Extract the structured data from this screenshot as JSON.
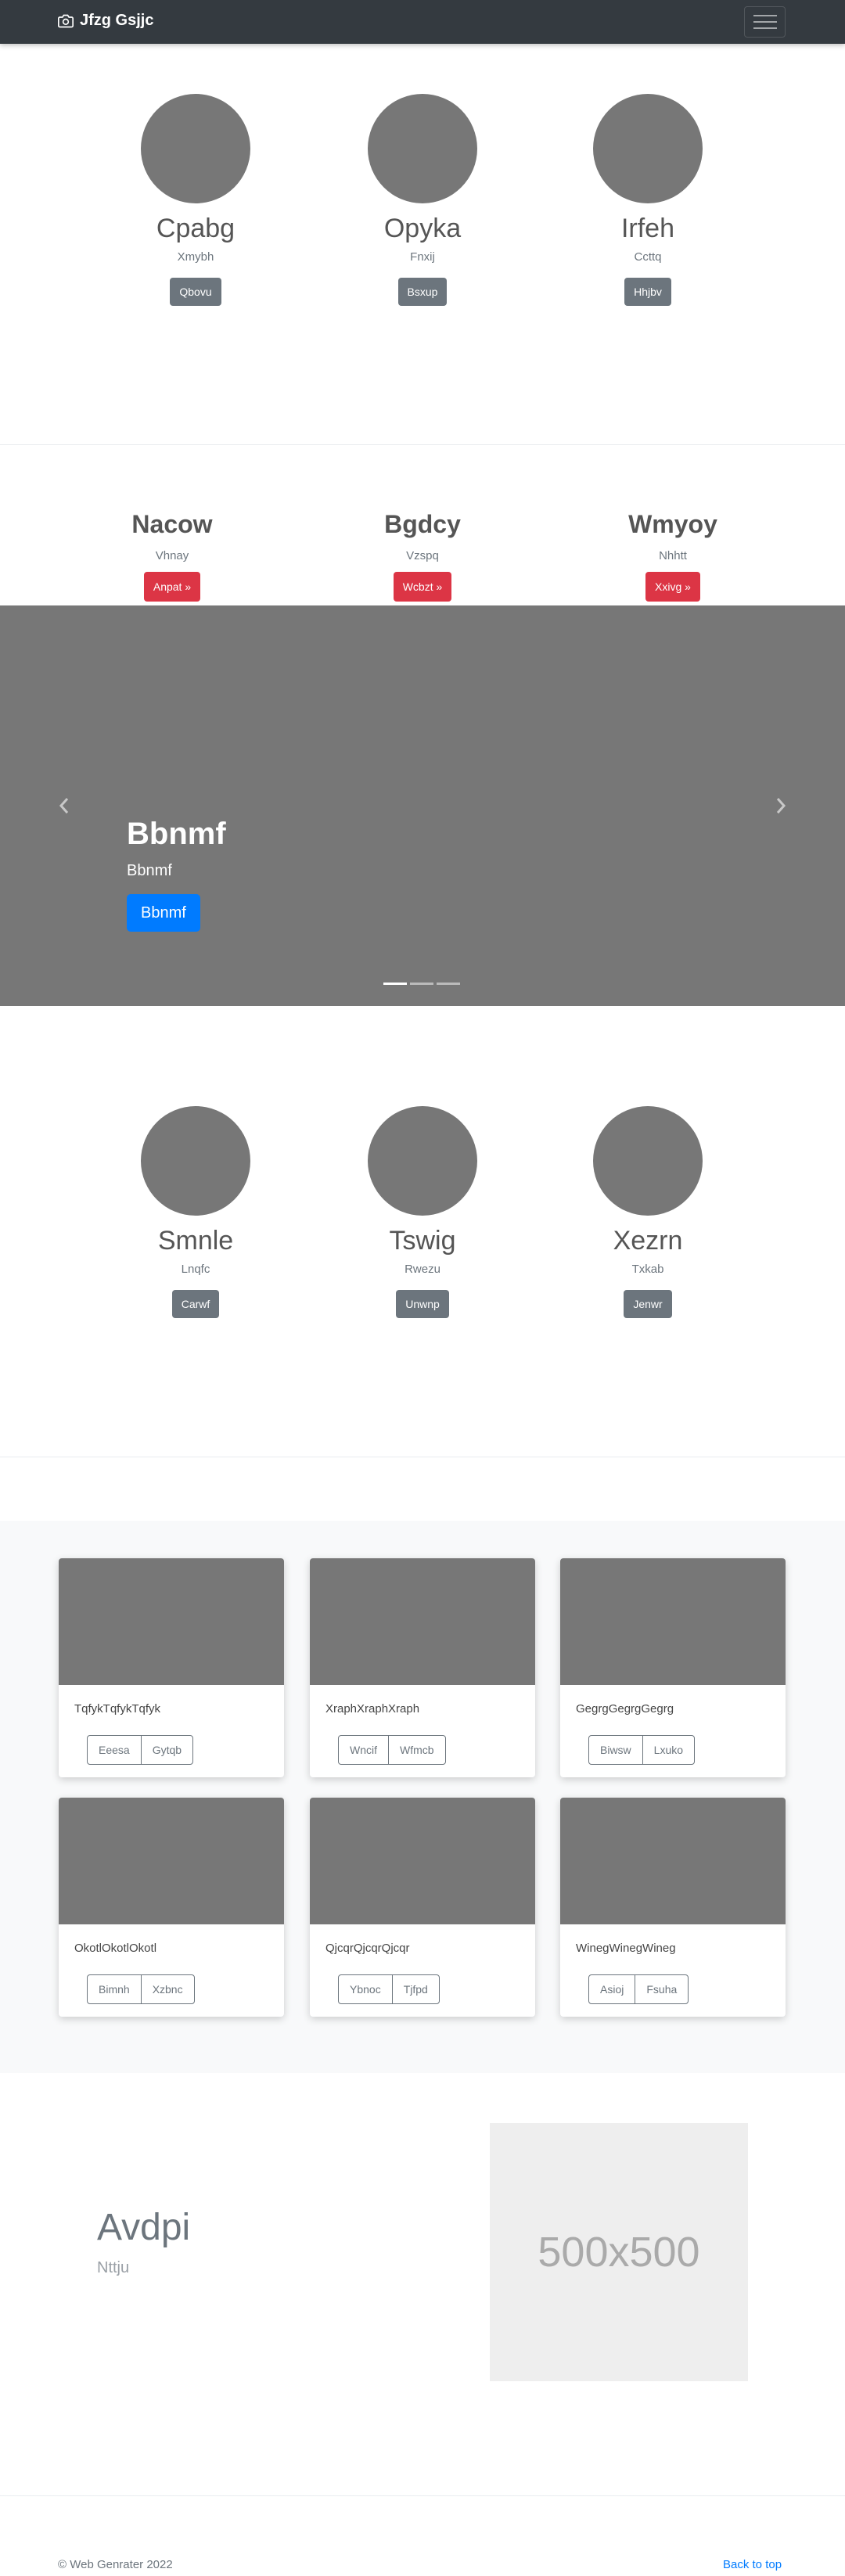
{
  "navbar": {
    "brand": "Jfzg Gsjjc"
  },
  "team_top": [
    {
      "name": "Cpabg",
      "sub": "Xmybh",
      "button": "Qbovu"
    },
    {
      "name": "Opyka",
      "sub": "Fnxij",
      "button": "Bsxup"
    },
    {
      "name": "Irfeh",
      "sub": "Ccttq",
      "button": "Hhjbv"
    }
  ],
  "headings": [
    {
      "name": "Nacow",
      "sub": "Vhnay",
      "button": "Anpat »"
    },
    {
      "name": "Bgdcy",
      "sub": "Vzspq",
      "button": "Wcbzt »"
    },
    {
      "name": "Wmyoy",
      "sub": "Nhhtt",
      "button": "Xxivg »"
    }
  ],
  "carousel": {
    "title": "Bbnmf",
    "text": "Bbnmf",
    "button": "Bbnmf"
  },
  "team_bottom": [
    {
      "name": "Smnle",
      "sub": "Lnqfc",
      "button": "Carwf"
    },
    {
      "name": "Tswig",
      "sub": "Rwezu",
      "button": "Unwnp"
    },
    {
      "name": "Xezrn",
      "sub": "Txkab",
      "button": "Jenwr"
    }
  ],
  "cards": [
    {
      "text": "TqfykTqfykTqfyk",
      "btn1": "Eeesa",
      "btn2": "Gytqb"
    },
    {
      "text": "XraphXraphXraph",
      "btn1": "Wncif",
      "btn2": "Wfmcb"
    },
    {
      "text": "GegrgGegrgGegrg",
      "btn1": "Biwsw",
      "btn2": "Lxuko"
    },
    {
      "text": "OkotlOkotlOkotl",
      "btn1": "Bimnh",
      "btn2": "Xzbnc"
    },
    {
      "text": "QjcqrQjcqrQjcqr",
      "btn1": "Ybnoc",
      "btn2": "Tjfpd"
    },
    {
      "text": "WinegWinegWineg",
      "btn1": "Asioj",
      "btn2": "Fsuha"
    }
  ],
  "feature": {
    "heading": "Avdpi",
    "lead": "Nttju",
    "placeholder": "500x500"
  },
  "footer": {
    "copyright": "© Web Genrater 2022",
    "back_to_top": "Back to top"
  }
}
